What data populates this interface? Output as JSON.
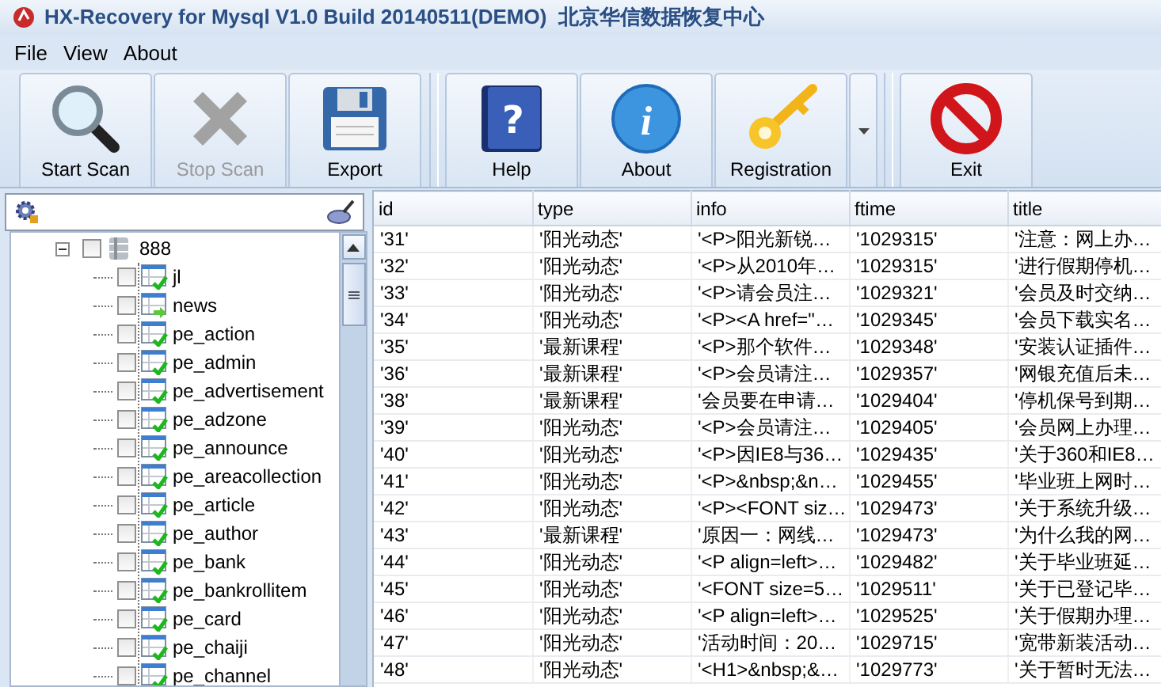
{
  "window": {
    "title": "HX-Recovery for Mysql V1.0 Build 20140511(DEMO)  北京华信数据恢复中心"
  },
  "menu": [
    "File",
    "View",
    "About"
  ],
  "toolbar": [
    {
      "kind": "button",
      "label": "Start Scan",
      "disabled": false
    },
    {
      "kind": "button",
      "label": "Stop Scan",
      "disabled": true
    },
    {
      "kind": "button",
      "label": "Export",
      "disabled": false
    },
    {
      "kind": "separator"
    },
    {
      "kind": "button",
      "glyph": "?",
      "label": "Help",
      "disabled": false
    },
    {
      "kind": "button",
      "glyph": "i",
      "label": "About",
      "disabled": false
    },
    {
      "kind": "button",
      "label": "Registration",
      "disabled": false
    },
    {
      "kind": "dropdown"
    },
    {
      "kind": "separator"
    },
    {
      "kind": "button",
      "label": "Exit",
      "disabled": false
    }
  ],
  "tree": {
    "root": {
      "label": "888",
      "checked": false,
      "expanded": true,
      "children": [
        {
          "label": "jl",
          "checked": false,
          "kind": "ok"
        },
        {
          "label": "news",
          "checked": false,
          "kind": "arrow"
        },
        {
          "label": "pe_action",
          "checked": false,
          "kind": "ok"
        },
        {
          "label": "pe_admin",
          "checked": false,
          "kind": "ok"
        },
        {
          "label": "pe_advertisement",
          "checked": false,
          "kind": "ok"
        },
        {
          "label": "pe_adzone",
          "checked": false,
          "kind": "ok"
        },
        {
          "label": "pe_announce",
          "checked": false,
          "kind": "ok"
        },
        {
          "label": "pe_areacollection",
          "checked": false,
          "kind": "ok"
        },
        {
          "label": "pe_article",
          "checked": false,
          "kind": "ok"
        },
        {
          "label": "pe_author",
          "checked": false,
          "kind": "ok"
        },
        {
          "label": "pe_bank",
          "checked": false,
          "kind": "ok"
        },
        {
          "label": "pe_bankrollitem",
          "checked": false,
          "kind": "ok"
        },
        {
          "label": "pe_card",
          "checked": false,
          "kind": "ok"
        },
        {
          "label": "pe_chaiji",
          "checked": false,
          "kind": "ok"
        },
        {
          "label": "pe_channel",
          "checked": false,
          "kind": "ok"
        }
      ]
    }
  },
  "table": {
    "columns": [
      "id",
      "type",
      "info",
      "ftime",
      "title"
    ],
    "rows": [
      [
        "'31'",
        "'阳光动态'",
        "'<P>阳光新锐…",
        "'1029315'",
        "'注意：网上办…"
      ],
      [
        "'32'",
        "'阳光动态'",
        "'<P>从2010年…",
        "'1029315'",
        "'进行假期停机…"
      ],
      [
        "'33'",
        "'阳光动态'",
        "'<P>请会员注…",
        "'1029321'",
        "'会员及时交纳…"
      ],
      [
        "'34'",
        "'阳光动态'",
        "'<P><A href=\"…",
        "'1029345'",
        "'会员下载实名…"
      ],
      [
        "'35'",
        "'最新课程'",
        "'<P>那个软件…",
        "'1029348'",
        "'安装认证插件…"
      ],
      [
        "'36'",
        "'最新课程'",
        "'<P>会员请注…",
        "'1029357'",
        "'网银充值后未…"
      ],
      [
        "'38'",
        "'最新课程'",
        "'会员要在申请…",
        "'1029404'",
        "'停机保号到期…"
      ],
      [
        "'39'",
        "'阳光动态'",
        "'<P>会员请注…",
        "'1029405'",
        "'会员网上办理…"
      ],
      [
        "'40'",
        "'阳光动态'",
        "'<P>因IE8与36…",
        "'1029435'",
        "'关于360和IE8…"
      ],
      [
        "'41'",
        "'阳光动态'",
        "'<P>&nbsp;&n…",
        "'1029455'",
        "'毕业班上网时…"
      ],
      [
        "'42'",
        "'阳光动态'",
        "'<P><FONT siz…",
        "'1029473'",
        "'关于系统升级…"
      ],
      [
        "'43'",
        "'最新课程'",
        "'原因一：网线…",
        "'1029473'",
        "'为什么我的网…"
      ],
      [
        "'44'",
        "'阳光动态'",
        "'<P align=left>…",
        "'1029482'",
        "'关于毕业班延…"
      ],
      [
        "'45'",
        "'阳光动态'",
        "'<FONT size=5…",
        "'1029511'",
        "'关于已登记毕…"
      ],
      [
        "'46'",
        "'阳光动态'",
        "'<P align=left>…",
        "'1029525'",
        "'关于假期办理…"
      ],
      [
        "'47'",
        "'阳光动态'",
        "'活动时间：20…",
        "'1029715'",
        "'宽带新装活动…"
      ],
      [
        "'48'",
        "'阳光动态'",
        "'<H1>&nbsp;&…",
        "'1029773'",
        "'关于暂时无法…"
      ]
    ]
  }
}
